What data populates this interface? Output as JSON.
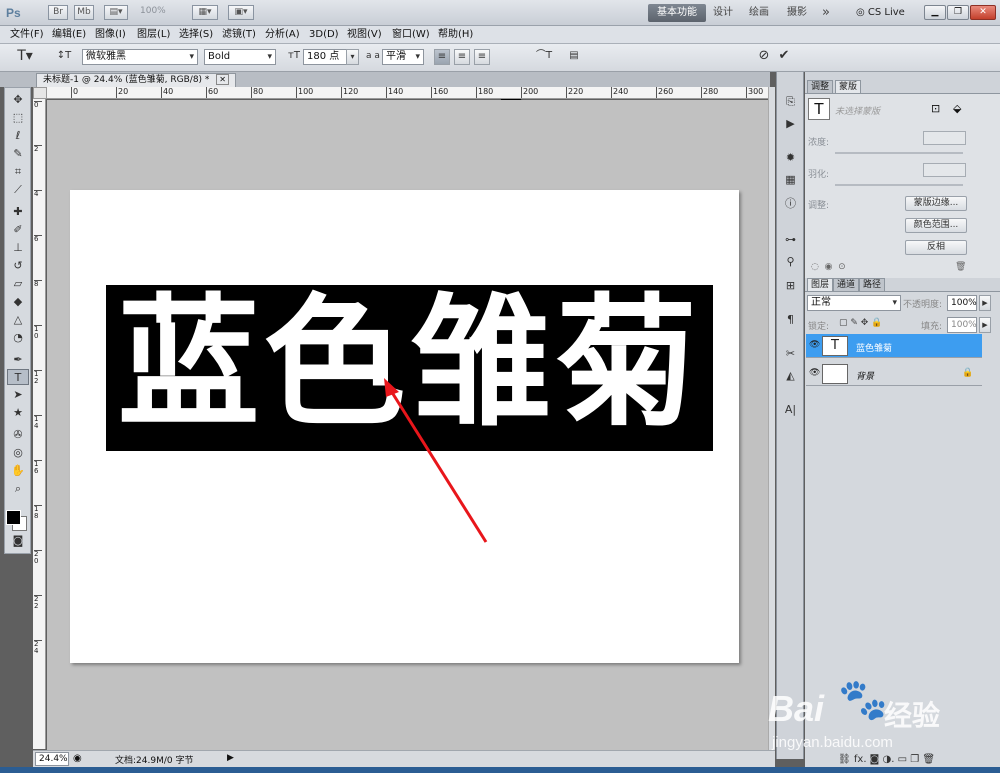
{
  "app": {
    "logo": "Ps",
    "zoom_display": "100%",
    "cs_live": "CS Live"
  },
  "workspaces": [
    "基本功能",
    "设计",
    "绘画",
    "摄影"
  ],
  "more_label": "»",
  "menu": [
    "文件(F)",
    "编辑(E)",
    "图像(I)",
    "图层(L)",
    "选择(S)",
    "滤镜(T)",
    "分析(A)",
    "3D(D)",
    "视图(V)",
    "窗口(W)",
    "帮助(H)"
  ],
  "options": {
    "font_family": "微软雅黑",
    "font_style": "Bold",
    "font_size": "180 点",
    "aa_prefix": "a a",
    "antialias": "平滑",
    "text_color": "#000000"
  },
  "document": {
    "tab_title": "未标题-1 @ 24.4% (蓝色雏菊, RGB/8) *",
    "text": "蓝色雏菊"
  },
  "ruler_top": [
    "0",
    "20",
    "40",
    "60",
    "80",
    "100",
    "120",
    "140",
    "160",
    "180",
    "200",
    "220",
    "240",
    "260",
    "280",
    "300"
  ],
  "ruler_left": [
    "0",
    "2",
    "4",
    "6",
    "8",
    "1\n0",
    "1\n2",
    "1\n4",
    "1\n6",
    "1\n8",
    "2\n0",
    "2\n2",
    "2\n4"
  ],
  "status": {
    "zoom": "24.4%",
    "doc_info": "文档:24.9M/0 字节"
  },
  "masks_panel": {
    "tabs": [
      "调整",
      "蒙版"
    ],
    "no_selection": "未选择蒙版",
    "density_label": "浓度:",
    "feather_label": "羽化:",
    "refine_label": "调整:",
    "btn_mask_edge": "蒙版边缘...",
    "btn_color_range": "颜色范围...",
    "btn_invert": "反相"
  },
  "layers_panel": {
    "tabs": [
      "图层",
      "通道",
      "路径"
    ],
    "blend_mode": "正常",
    "opacity_label": "不透明度:",
    "opacity": "100%",
    "lock_label": "锁定:",
    "fill_label": "填充:",
    "fill": "100%",
    "layers": [
      {
        "name": "蓝色雏菊",
        "thumb": "T"
      },
      {
        "name": "背景",
        "thumb": ""
      }
    ]
  },
  "watermark": {
    "brand": "Bai",
    "brand2": "经验",
    "url": "jingyan.baidu.com"
  },
  "colors": {
    "accent": "#3d9df0",
    "annotation_arrow": "#e8161b"
  }
}
